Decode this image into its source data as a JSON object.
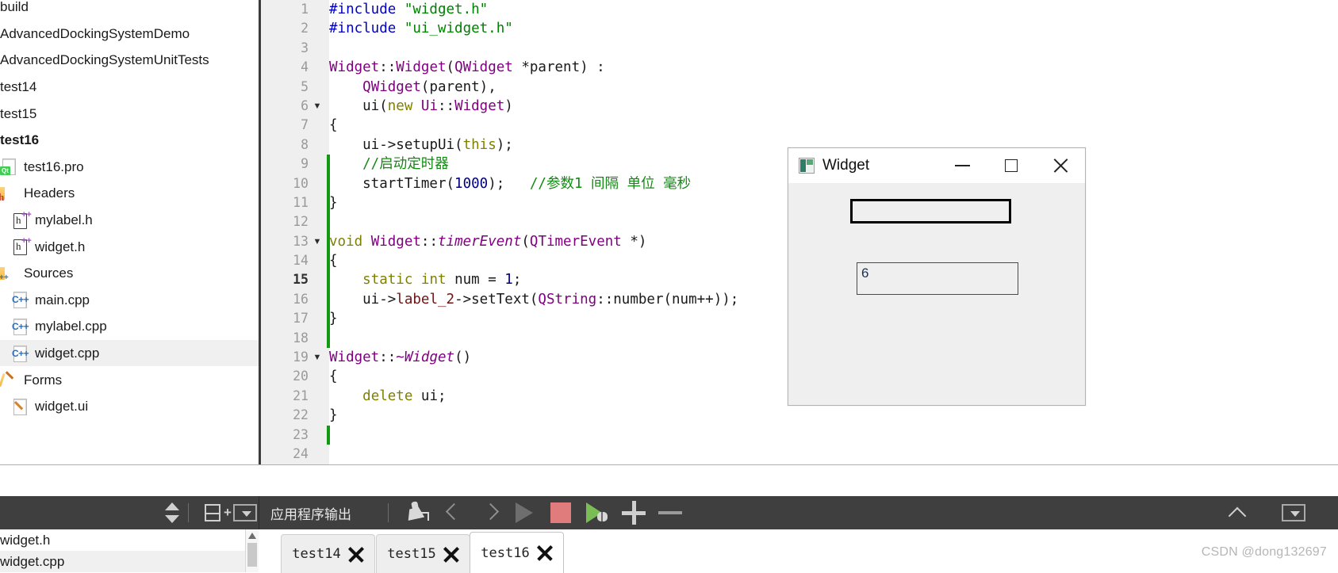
{
  "project_tree": {
    "items": [
      {
        "label": "build",
        "icon": "none",
        "indent": 0,
        "bold": false,
        "selected": false,
        "clipped": true
      },
      {
        "label": "AdvancedDockingSystemDemo",
        "icon": "none",
        "indent": 0,
        "bold": false,
        "selected": false
      },
      {
        "label": "AdvancedDockingSystemUnitTests",
        "icon": "none",
        "indent": 0,
        "bold": false,
        "selected": false
      },
      {
        "label": "test14",
        "icon": "none",
        "indent": 0,
        "bold": false,
        "selected": false
      },
      {
        "label": "test15",
        "icon": "none",
        "indent": 0,
        "bold": false,
        "selected": false
      },
      {
        "label": "test16",
        "icon": "none",
        "indent": 0,
        "bold": true,
        "selected": false
      },
      {
        "label": "test16.pro",
        "icon": "qt-project-file-icon",
        "indent": 1,
        "bold": false,
        "selected": false
      },
      {
        "label": "Headers",
        "icon": "headers-folder-icon",
        "indent": 1,
        "bold": false,
        "selected": false
      },
      {
        "label": "mylabel.h",
        "icon": "header-file-icon",
        "indent": 2,
        "bold": false,
        "selected": false
      },
      {
        "label": "widget.h",
        "icon": "header-file-icon",
        "indent": 2,
        "bold": false,
        "selected": false
      },
      {
        "label": "Sources",
        "icon": "sources-folder-icon",
        "indent": 1,
        "bold": false,
        "selected": false
      },
      {
        "label": "main.cpp",
        "icon": "cpp-file-icon",
        "indent": 2,
        "bold": false,
        "selected": false
      },
      {
        "label": "mylabel.cpp",
        "icon": "cpp-file-icon",
        "indent": 2,
        "bold": false,
        "selected": false
      },
      {
        "label": "widget.cpp",
        "icon": "cpp-file-icon",
        "indent": 2,
        "bold": false,
        "selected": true
      },
      {
        "label": "Forms",
        "icon": "forms-folder-icon",
        "indent": 1,
        "bold": false,
        "selected": false
      },
      {
        "label": "widget.ui",
        "icon": "ui-file-icon",
        "indent": 2,
        "bold": false,
        "selected": false
      }
    ]
  },
  "editor": {
    "current_line": 15,
    "lines": [
      {
        "n": "1",
        "fold": "",
        "changed": false,
        "tokens": [
          {
            "t": "#include ",
            "c": "c-pre"
          },
          {
            "t": "\"widget.h\"",
            "c": "c-str"
          }
        ]
      },
      {
        "n": "2",
        "fold": "",
        "changed": false,
        "tokens": [
          {
            "t": "#include ",
            "c": "c-pre"
          },
          {
            "t": "\"ui_widget.h\"",
            "c": "c-str"
          }
        ]
      },
      {
        "n": "3",
        "fold": "",
        "changed": false,
        "tokens": []
      },
      {
        "n": "4",
        "fold": "",
        "changed": false,
        "tokens": [
          {
            "t": "Widget",
            "c": "c-type"
          },
          {
            "t": "::",
            "c": "c-pl"
          },
          {
            "t": "Widget",
            "c": "c-type"
          },
          {
            "t": "(",
            "c": "c-pl"
          },
          {
            "t": "QWidget",
            "c": "c-type"
          },
          {
            "t": " *parent) :",
            "c": "c-pl"
          }
        ]
      },
      {
        "n": "5",
        "fold": "",
        "changed": false,
        "tokens": [
          {
            "t": "    ",
            "c": "c-pl"
          },
          {
            "t": "QWidget",
            "c": "c-type"
          },
          {
            "t": "(parent),",
            "c": "c-pl"
          }
        ]
      },
      {
        "n": "6",
        "fold": "▼",
        "changed": false,
        "tokens": [
          {
            "t": "    ui(",
            "c": "c-pl"
          },
          {
            "t": "new",
            "c": "c-kw"
          },
          {
            "t": " ",
            "c": "c-pl"
          },
          {
            "t": "Ui",
            "c": "c-type"
          },
          {
            "t": "::",
            "c": "c-pl"
          },
          {
            "t": "Widget",
            "c": "c-type"
          },
          {
            "t": ")",
            "c": "c-pl"
          }
        ]
      },
      {
        "n": "7",
        "fold": "",
        "changed": false,
        "tokens": [
          {
            "t": "{",
            "c": "c-pl"
          }
        ]
      },
      {
        "n": "8",
        "fold": "",
        "changed": false,
        "tokens": [
          {
            "t": "    ui->",
            "c": "c-pl"
          },
          {
            "t": "setupUi",
            "c": "c-pl"
          },
          {
            "t": "(",
            "c": "c-pl"
          },
          {
            "t": "this",
            "c": "c-kw"
          },
          {
            "t": ");",
            "c": "c-pl"
          }
        ]
      },
      {
        "n": "9",
        "fold": "",
        "changed": true,
        "tokens": [
          {
            "t": "    //启动定时器",
            "c": "c-com"
          }
        ]
      },
      {
        "n": "10",
        "fold": "",
        "changed": true,
        "tokens": [
          {
            "t": "    startTimer(",
            "c": "c-pl"
          },
          {
            "t": "1000",
            "c": "c-num"
          },
          {
            "t": ");   ",
            "c": "c-pl"
          },
          {
            "t": "//参数1 间隔 单位 毫秒",
            "c": "c-com"
          }
        ]
      },
      {
        "n": "11",
        "fold": "",
        "changed": true,
        "tokens": [
          {
            "t": "}",
            "c": "c-pl"
          }
        ]
      },
      {
        "n": "12",
        "fold": "",
        "changed": true,
        "tokens": []
      },
      {
        "n": "13",
        "fold": "▼",
        "changed": true,
        "tokens": [
          {
            "t": "void",
            "c": "c-kw"
          },
          {
            "t": " ",
            "c": "c-pl"
          },
          {
            "t": "Widget",
            "c": "c-type"
          },
          {
            "t": "::",
            "c": "c-pl"
          },
          {
            "t": "timerEvent",
            "c": "c-fn"
          },
          {
            "t": "(",
            "c": "c-pl"
          },
          {
            "t": "QTimerEvent",
            "c": "c-type"
          },
          {
            "t": " *)",
            "c": "c-pl"
          }
        ]
      },
      {
        "n": "14",
        "fold": "",
        "changed": true,
        "tokens": [
          {
            "t": "{",
            "c": "c-pl"
          }
        ]
      },
      {
        "n": "15",
        "fold": "",
        "changed": true,
        "tokens": [
          {
            "t": "    ",
            "c": "c-pl"
          },
          {
            "t": "static",
            "c": "c-kw"
          },
          {
            "t": " ",
            "c": "c-pl"
          },
          {
            "t": "int",
            "c": "c-kw"
          },
          {
            "t": " num = ",
            "c": "c-pl"
          },
          {
            "t": "1",
            "c": "c-num"
          },
          {
            "t": ";",
            "c": "c-pl"
          }
        ]
      },
      {
        "n": "16",
        "fold": "",
        "changed": true,
        "tokens": [
          {
            "t": "    ui->",
            "c": "c-pl"
          },
          {
            "t": "label_2",
            "c": "c-field"
          },
          {
            "t": "->setText(",
            "c": "c-pl"
          },
          {
            "t": "QString",
            "c": "c-type"
          },
          {
            "t": "::number(num++));",
            "c": "c-pl"
          }
        ]
      },
      {
        "n": "17",
        "fold": "",
        "changed": true,
        "tokens": [
          {
            "t": "}",
            "c": "c-pl"
          }
        ]
      },
      {
        "n": "18",
        "fold": "",
        "changed": true,
        "tokens": []
      },
      {
        "n": "19",
        "fold": "▼",
        "changed": false,
        "tokens": [
          {
            "t": "Widget",
            "c": "c-type"
          },
          {
            "t": "::",
            "c": "c-pl"
          },
          {
            "t": "~Widget",
            "c": "c-fn"
          },
          {
            "t": "()",
            "c": "c-pl"
          }
        ]
      },
      {
        "n": "20",
        "fold": "",
        "changed": false,
        "tokens": [
          {
            "t": "{",
            "c": "c-pl"
          }
        ]
      },
      {
        "n": "21",
        "fold": "",
        "changed": false,
        "tokens": [
          {
            "t": "    ",
            "c": "c-pl"
          },
          {
            "t": "delete",
            "c": "c-kw"
          },
          {
            "t": " ui;",
            "c": "c-pl"
          }
        ]
      },
      {
        "n": "22",
        "fold": "",
        "changed": false,
        "tokens": [
          {
            "t": "}",
            "c": "c-pl"
          }
        ]
      },
      {
        "n": "23",
        "fold": "",
        "changed": true,
        "tokens": []
      },
      {
        "n": "24",
        "fold": "",
        "changed": false,
        "tokens": []
      }
    ]
  },
  "widget_dialog": {
    "title": "Widget",
    "icon": "qt-widget-icon",
    "minimize_label": "—",
    "maximize_label": "□",
    "close_label": "✕",
    "label_top_text": "",
    "label_counter_text": "6"
  },
  "bottom_toolbar": {
    "left": {
      "updown_icon": "up-down-arrows-icon",
      "split_icon": "split-view-add-icon",
      "dropdown_icon": "dropdown-icon"
    },
    "right": {
      "pane_title": "应用程序输出",
      "clear_icon": "broom-clear-icon",
      "prev_icon": "chevron-left-icon",
      "next_icon": "chevron-right-icon",
      "run_icon": "run-play-icon",
      "stop_icon": "stop-square-icon",
      "debug_icon": "debug-run-icon",
      "zoom_in_icon": "plus-icon",
      "zoom_out_icon": "minus-icon",
      "collapse_icon": "chevron-up-icon",
      "options_icon": "dropdown-icon"
    }
  },
  "bottom_file_list": {
    "items": [
      {
        "label": "widget.cpp",
        "selected": true
      },
      {
        "label": "widget.h",
        "selected": false
      }
    ]
  },
  "bottom_tabs": {
    "items": [
      {
        "label": "test14",
        "active": false,
        "close_icon": "close-x-icon"
      },
      {
        "label": "test15",
        "active": false,
        "close_icon": "close-x-icon"
      },
      {
        "label": "test16",
        "active": true,
        "close_icon": "close-x-icon"
      }
    ]
  },
  "watermark": {
    "text": "CSDN @dong132697"
  }
}
